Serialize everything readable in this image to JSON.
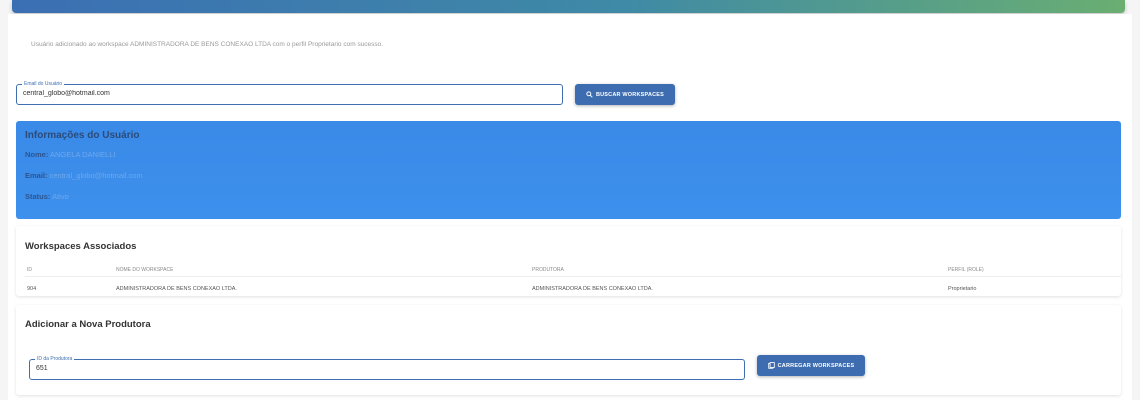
{
  "status": {
    "success_message": "Usuário adicionado ao workspace ADMINISTRADORA DE BENS CONEXAO LTDA com o perfil Proprietario com sucesso."
  },
  "search": {
    "email_label": "Email do Usuário",
    "email_value": "central_globo@hotmail.com",
    "button_label": "BUSCAR WORKSPACES"
  },
  "user_info": {
    "title": "Informações do Usuário",
    "name_label": "Nome:",
    "name_value": "ANGELA DANIELLI",
    "email_label": "Email:",
    "email_value": "central_globo@hotmail.com",
    "status_label": "Status:",
    "status_value": "Ativo"
  },
  "workspaces": {
    "title": "Workspaces Associados",
    "columns": [
      "ID",
      "NOME DO WORKSPACE",
      "PRODUTORA",
      "PERFIL (ROLE)"
    ],
    "rows": [
      [
        "904",
        "ADMINISTRADORA DE BENS CONEXAO LTDA.",
        "ADMINISTRADORA DE BENS CONEXAO LTDA.",
        "Proprietario"
      ]
    ]
  },
  "add_producer": {
    "title": "Adicionar a Nova Produtora",
    "id_label": "ID da Produtora",
    "id_value": "651",
    "button_label": "CARREGAR WORKSPACES"
  },
  "icons": {
    "search": "search-icon",
    "load": "document-icon"
  },
  "colors": {
    "primary": "#3d6db0",
    "info_panel": "#3a8ae8"
  }
}
